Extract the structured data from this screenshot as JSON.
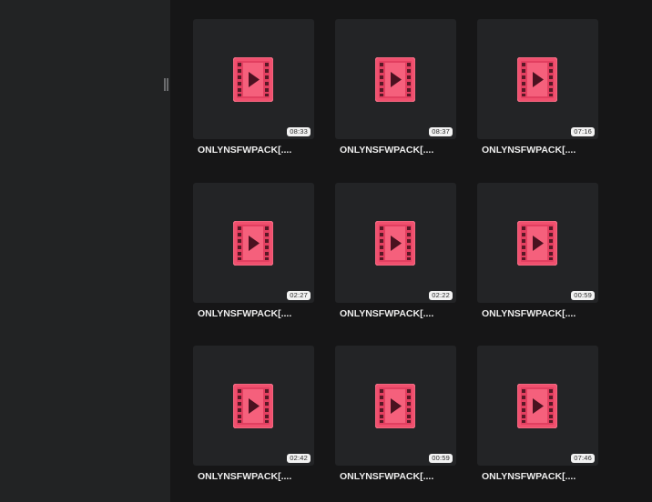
{
  "colors": {
    "sidebar_bg": "#222324",
    "main_bg": "#161617",
    "card_bg": "#232426",
    "video_icon_accent": "#f0506e",
    "title_text": "#ececec"
  },
  "sidebar": {
    "resize_handle_icon": "resize-handle-icon"
  },
  "files": [
    {
      "title": "ONLYNSFWPACK[....",
      "duration": "08:33",
      "icon": "video-file-icon"
    },
    {
      "title": "ONLYNSFWPACK[....",
      "duration": "08:37",
      "icon": "video-file-icon"
    },
    {
      "title": "ONLYNSFWPACK[....",
      "duration": "07:16",
      "icon": "video-file-icon"
    },
    {
      "title": "ONLYNSFWPACK[....",
      "duration": "02:27",
      "icon": "video-file-icon"
    },
    {
      "title": "ONLYNSFWPACK[....",
      "duration": "02:22",
      "icon": "video-file-icon"
    },
    {
      "title": "ONLYNSFWPACK[....",
      "duration": "00:59",
      "icon": "video-file-icon"
    },
    {
      "title": "ONLYNSFWPACK[....",
      "duration": "02:42",
      "icon": "video-file-icon"
    },
    {
      "title": "ONLYNSFWPACK[....",
      "duration": "00:59",
      "icon": "video-file-icon"
    },
    {
      "title": "ONLYNSFWPACK[....",
      "duration": "07:46",
      "icon": "video-file-icon"
    }
  ]
}
